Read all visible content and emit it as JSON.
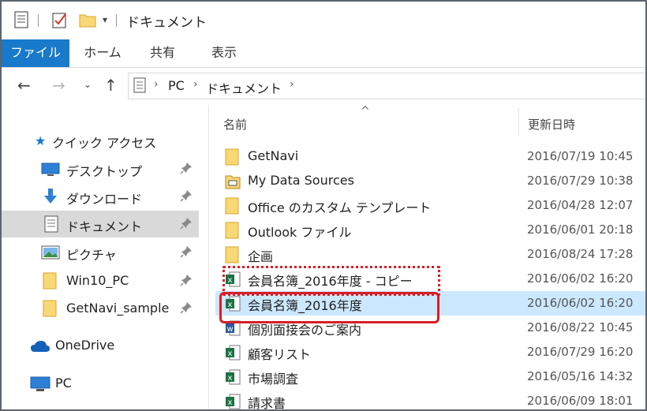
{
  "window": {
    "title": "ドキュメント"
  },
  "ribbon": {
    "tabs": [
      {
        "label": "ファイル",
        "active": true
      },
      {
        "label": "ホーム",
        "active": false
      },
      {
        "label": "共有",
        "active": false
      },
      {
        "label": "表示",
        "active": false
      }
    ],
    "accent": "#1979ca"
  },
  "address": {
    "segments": [
      "PC",
      "ドキュメント"
    ]
  },
  "sidebar": {
    "quick_access": "クイック アクセス",
    "items": [
      {
        "label": "デスクトップ",
        "icon": "desktop-icon",
        "pinned": true
      },
      {
        "label": "ダウンロード",
        "icon": "download-icon",
        "pinned": true
      },
      {
        "label": "ドキュメント",
        "icon": "document-icon",
        "pinned": true,
        "selected": true
      },
      {
        "label": "ピクチャ",
        "icon": "picture-icon",
        "pinned": true
      },
      {
        "label": "Win10_PC",
        "icon": "folder-icon",
        "pinned": true
      },
      {
        "label": "GetNavi_sample",
        "icon": "folder-icon",
        "pinned": true
      }
    ],
    "onedrive": "OneDrive",
    "pc": "PC"
  },
  "list": {
    "col_name": "名前",
    "col_date": "更新日時",
    "sort_indicator": "^",
    "files": [
      {
        "name": "GetNavi",
        "date": "2016/07/19 10:45",
        "icon": "folder-icon"
      },
      {
        "name": "My Data Sources",
        "date": "2016/07/29 10:38",
        "icon": "data-folder-icon"
      },
      {
        "name": "Office のカスタム テンプレート",
        "date": "2016/04/28 12:07",
        "icon": "folder-icon"
      },
      {
        "name": "Outlook ファイル",
        "date": "2016/06/01 20:18",
        "icon": "folder-icon"
      },
      {
        "name": "企画",
        "date": "2016/08/24 17:28",
        "icon": "folder-icon"
      },
      {
        "name": "会員名簿_2016年度 - コピー",
        "date": "2016/06/02 16:20",
        "icon": "excel-icon"
      },
      {
        "name": "会員名簿_2016年度",
        "date": "2016/06/02 16:20",
        "icon": "excel-icon",
        "selected": true
      },
      {
        "name": "個別面接会のご案内",
        "date": "2016/08/22 10:45",
        "icon": "word-icon"
      },
      {
        "name": "顧客リスト",
        "date": "2016/07/29 16:20",
        "icon": "excel-icon"
      },
      {
        "name": "市場調査",
        "date": "2016/05/16 14:32",
        "icon": "excel-icon"
      },
      {
        "name": "請求書",
        "date": "2016/06/09 18:01",
        "icon": "excel-icon"
      }
    ]
  },
  "colors": {
    "selection": "#cce8ff",
    "highlight": "#d61f26",
    "folder": "#f8d775",
    "excel": "#1e7145",
    "word": "#2b579a"
  }
}
